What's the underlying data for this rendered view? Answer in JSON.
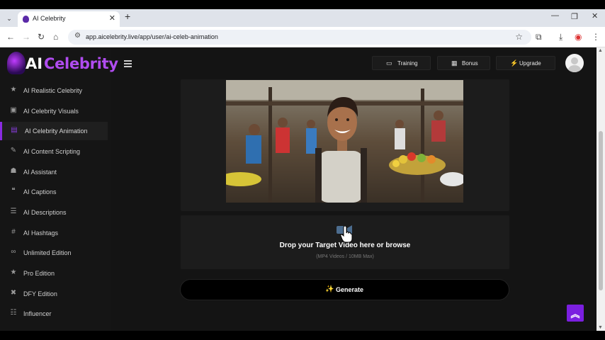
{
  "browser": {
    "tab_title": "AI Celebrity",
    "url": "app.aicelebrity.live/app/user/ai-celeb-animation"
  },
  "logo": {
    "part1": "AI",
    "part2": "Celebrity"
  },
  "sidebar": {
    "items": [
      {
        "label": "AI Realistic Celebrity",
        "icon": "★"
      },
      {
        "label": "AI Celebrity Visuals",
        "icon": "▣"
      },
      {
        "label": "AI Celebrity Animation",
        "icon": "▤"
      },
      {
        "label": "AI Content Scripting",
        "icon": "✎"
      },
      {
        "label": "AI Assistant",
        "icon": "☗"
      },
      {
        "label": "AI Captions",
        "icon": "❝"
      },
      {
        "label": "AI Descriptions",
        "icon": "☰"
      },
      {
        "label": "AI Hashtags",
        "icon": "#"
      },
      {
        "label": "Unlimited Edition",
        "icon": "∞"
      },
      {
        "label": "Pro Edition",
        "icon": "★"
      },
      {
        "label": "DFY Edition",
        "icon": "✖"
      },
      {
        "label": "Influencer",
        "icon": "☷"
      }
    ]
  },
  "header": {
    "training_label": "Training",
    "bonus_label": "Bonus",
    "upgrade_label": "Upgrade"
  },
  "upload": {
    "title": "Drop your Target Video here or browse",
    "subtitle": "(MP4 Videos / 10MB Max)"
  },
  "generate": {
    "label": "Generate"
  },
  "colors": {
    "accent": "#8a2be2",
    "background": "#141414"
  }
}
